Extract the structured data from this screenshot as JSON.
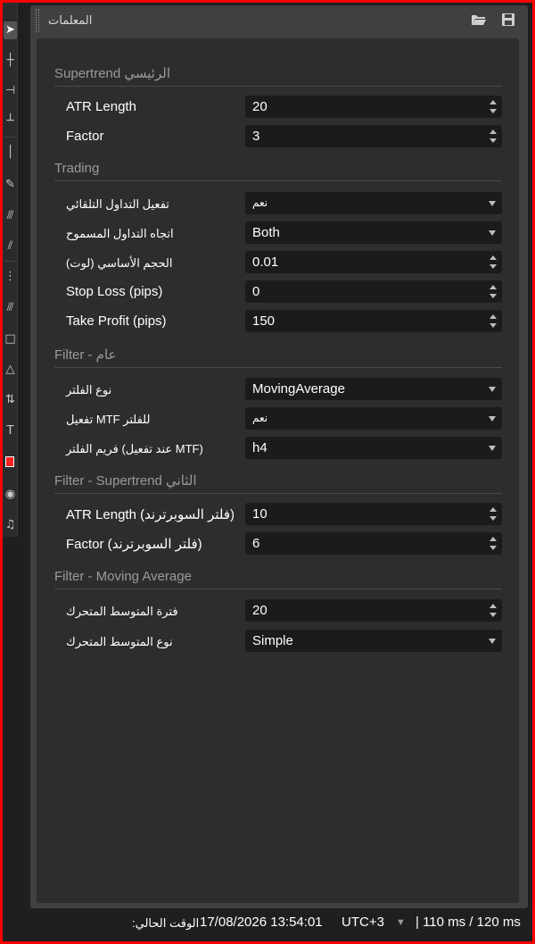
{
  "panel": {
    "title": "المعلمات"
  },
  "sections": {
    "supertrend_main": "Supertrend الرئيسي",
    "trading": "Trading",
    "filter_general": "Filter - عام",
    "filter_supertrend2": "Filter - Supertrend الثاني",
    "filter_ma": "Filter - Moving Average"
  },
  "params": {
    "atr_length": {
      "label": "ATR Length",
      "value": "20"
    },
    "factor": {
      "label": "Factor",
      "value": "3"
    },
    "auto_trading": {
      "label": "تفعيل التداول التلقائي",
      "value": "نعم"
    },
    "trade_direction": {
      "label": "اتجاه التداول المسموح",
      "value": "Both"
    },
    "lot_size": {
      "label": "(الحجم الأساسي (لوت",
      "value": "0.01"
    },
    "stop_loss": {
      "label": "Stop Loss (pips)",
      "value": "0"
    },
    "take_profit": {
      "label": "Take Profit (pips)",
      "value": "150"
    },
    "filter_type": {
      "label": "نوع الفلتر",
      "value": "MovingAverage"
    },
    "mtf_enable": {
      "label": "تفعيل MTF للفلتر",
      "value": "نعم"
    },
    "filter_tf": {
      "label": "فريم الفلتر (عند تفعيل MTF)",
      "value": "h4"
    },
    "atr_length_2": {
      "label": "ATR Length (فلتر السوبرترند)",
      "value": "10"
    },
    "factor_2": {
      "label": "Factor (فلتر السوبرترند)",
      "value": "6"
    },
    "ma_period": {
      "label": "فترة المتوسط المتحرك",
      "value": "20"
    },
    "ma_type": {
      "label": "نوع المتوسط المتحرك",
      "value": "Simple"
    }
  },
  "status": {
    "time_label": ":الوقت الحالي",
    "datetime": "17/08/2026 13:54:01",
    "timezone": "UTC+3",
    "latency": "| 110 ms / 120 ms"
  },
  "colors": {
    "frame": "#ff0000",
    "field_bg": "#1b1b1b",
    "content_bg": "#2d2d2d",
    "panel_bg": "#404040"
  }
}
